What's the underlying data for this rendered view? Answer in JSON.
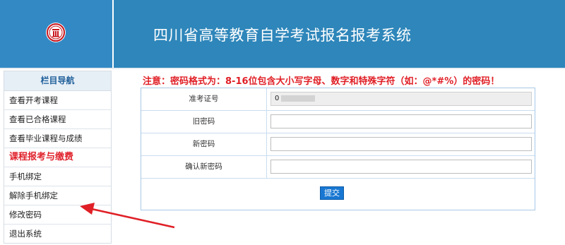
{
  "header": {
    "title": "四川省高等教育自学考试报名报考系统",
    "logo_icon": "university-seal-icon",
    "colors": {
      "logo_bg": "#3389c4",
      "title_bg": "#2e86ba"
    }
  },
  "sidebar": {
    "heading": "栏目导航",
    "items": [
      {
        "label": "查看开考课程"
      },
      {
        "label": "查看已合格课程"
      },
      {
        "label": "查看毕业课程与成绩"
      },
      {
        "label": "课程报考与缴费"
      },
      {
        "label": "手机绑定"
      },
      {
        "label": "解除手机绑定"
      },
      {
        "label": "修改密码"
      },
      {
        "label": "退出系统"
      }
    ]
  },
  "notice": "注意：密码格式为：8-16位包含大小写字母、数字和特殊字符（如：@*#%）的密码！",
  "form": {
    "fields": [
      {
        "label": "准考证号",
        "value": "0"
      },
      {
        "label": "旧密码",
        "value": ""
      },
      {
        "label": "新密码",
        "value": ""
      },
      {
        "label": "确认新密码",
        "value": ""
      }
    ],
    "submit_label": "提交"
  },
  "annotation": {
    "arrow_color": "#e01f26",
    "arrow_icon": "red-arrow-pointer"
  }
}
